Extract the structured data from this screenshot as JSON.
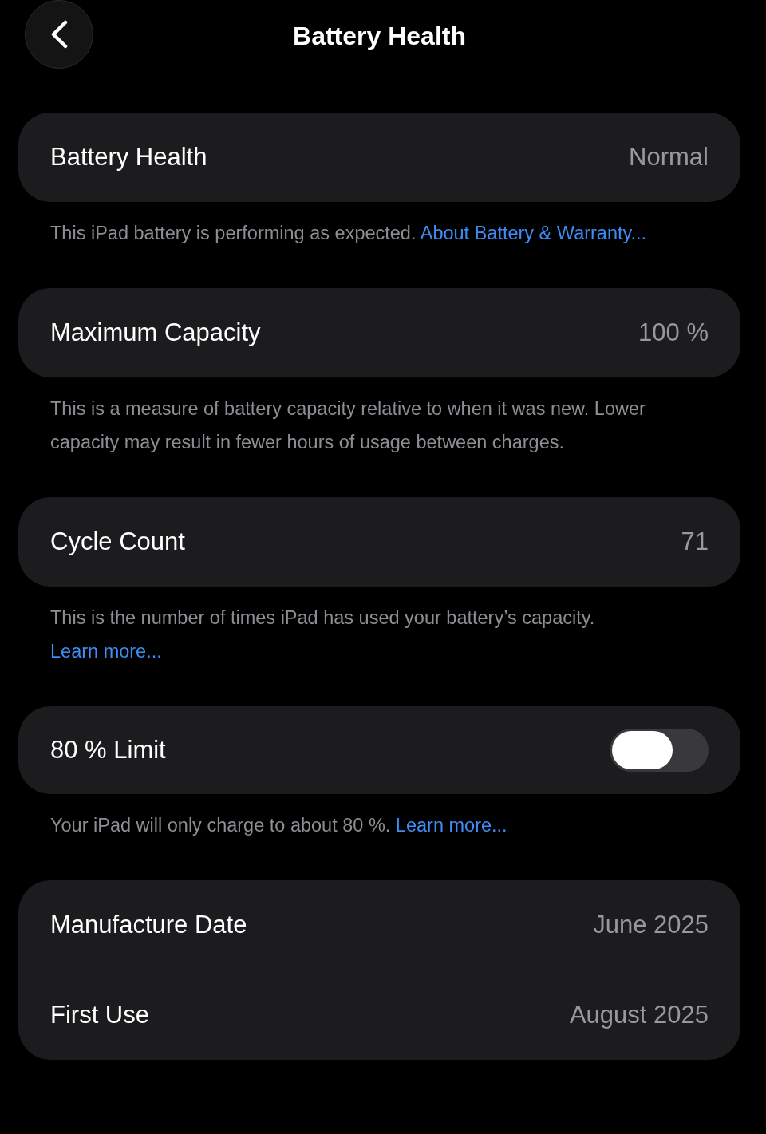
{
  "header": {
    "title": "Battery Health"
  },
  "sections": [
    {
      "rows": [
        {
          "kind": "value",
          "label": "Battery Health",
          "value": "Normal"
        }
      ],
      "note": {
        "text": "This iPad battery is performing as expected.",
        "link": "About Battery & Warranty..."
      }
    },
    {
      "rows": [
        {
          "kind": "value",
          "label": "Maximum Capacity",
          "value": "100 %"
        }
      ],
      "note": {
        "text": "This is a measure of battery capacity relative to when it was new. Lower capacity may result in fewer hours of usage between charges."
      }
    },
    {
      "rows": [
        {
          "kind": "value",
          "label": "Cycle Count",
          "value": "71"
        }
      ],
      "note": {
        "text": "This is the number of times iPad has used your battery’s capacity.",
        "link": "Learn more..."
      }
    },
    {
      "rows": [
        {
          "kind": "toggle",
          "label": "80 % Limit",
          "on": false
        }
      ],
      "note": {
        "text": "Your iPad will only charge to about 80 %.",
        "link": "Learn more..."
      }
    },
    {
      "rows": [
        {
          "kind": "value",
          "label": "Manufacture Date",
          "value": "June 2025"
        },
        {
          "kind": "value",
          "label": "First Use",
          "value": "August 2025"
        }
      ]
    }
  ]
}
